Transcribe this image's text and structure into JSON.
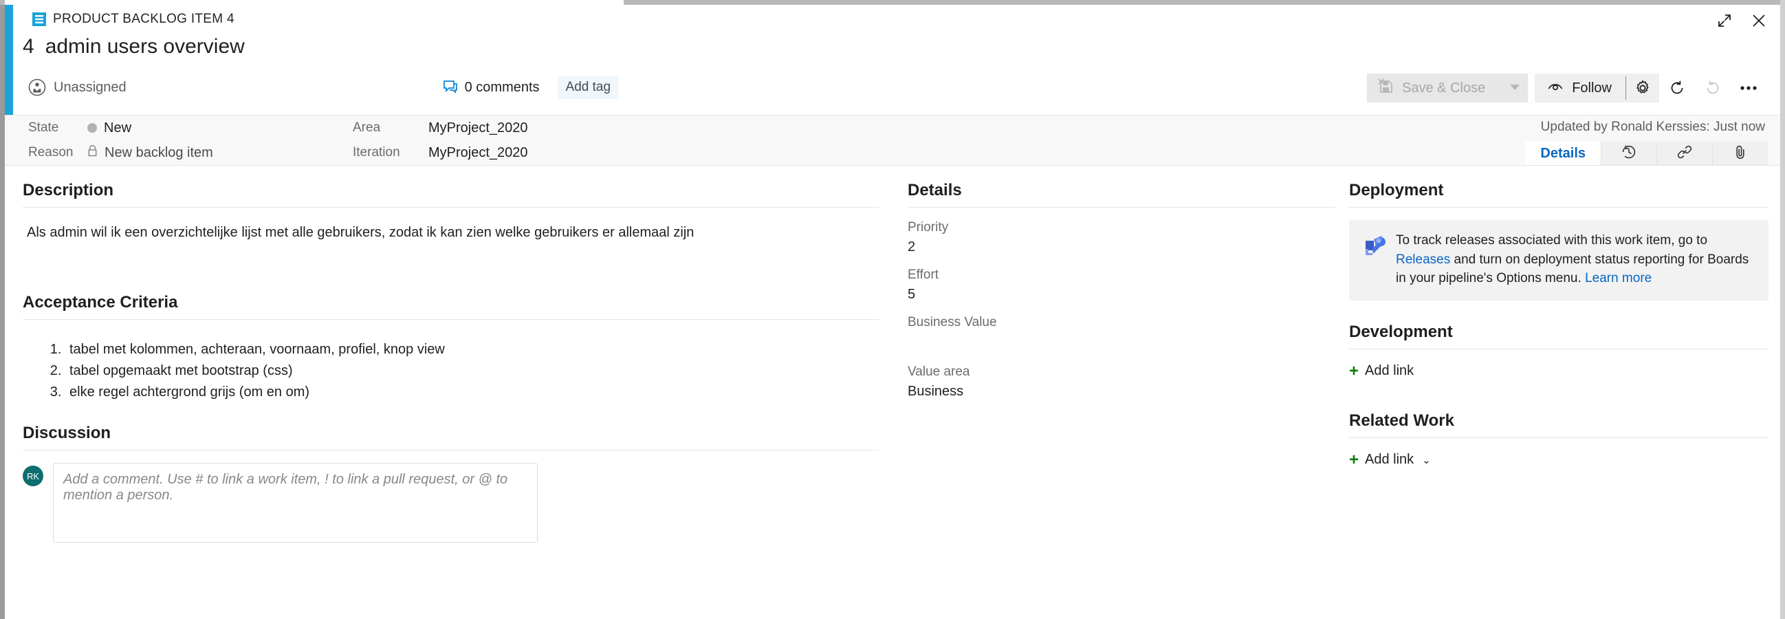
{
  "window": {
    "expand_icon": "expand-icon",
    "close_icon": "close-icon"
  },
  "header": {
    "type_icon": "backlog-item-icon",
    "work_item_type": "PRODUCT BACKLOG ITEM 4",
    "work_item_id": "4",
    "title": "admin users overview",
    "assignee_icon": "person-icon",
    "assignee": "Unassigned",
    "comment_icon": "comment-icon",
    "comments": "0 comments",
    "add_tag": "Add tag"
  },
  "toolbar": {
    "save_icon": "save-close-icon",
    "save_close": "Save & Close",
    "save_caret": "caret-down-icon",
    "follow_icon": "follow-eye-icon",
    "follow": "Follow",
    "gear_icon": "gear-icon",
    "refresh_icon": "refresh-icon",
    "undo_icon": "undo-icon",
    "more_icon": "more-ellipsis-icon"
  },
  "fields": {
    "state_label": "State",
    "state_value": "New",
    "state_color": "#b2b2b2",
    "reason_label": "Reason",
    "reason_value": "New backlog item",
    "reason_icon": "lock-icon",
    "area_label": "Area",
    "area_value": "MyProject_2020",
    "iteration_label": "Iteration",
    "iteration_value": "MyProject_2020"
  },
  "status": {
    "updated_by": "Updated by Ronald Kerssies: Just now"
  },
  "tabs": [
    {
      "label": "Details",
      "icon": "",
      "active": true
    },
    {
      "label": "",
      "icon": "history-icon",
      "active": false
    },
    {
      "label": "",
      "icon": "link-icon",
      "active": false
    },
    {
      "label": "",
      "icon": "attachment-icon",
      "active": false
    }
  ],
  "description": {
    "heading": "Description",
    "body": "Als admin wil ik een overzichtelijke lijst met alle gebruikers, zodat ik kan zien welke gebruikers er allemaal zijn"
  },
  "acceptance_criteria": {
    "heading": "Acceptance Criteria",
    "items": [
      "tabel met kolommen, achteraan, voornaam, profiel, knop view",
      "tabel opgemaakt met bootstrap (css)",
      "elke regel achtergrond grijs (om en om)"
    ]
  },
  "discussion": {
    "heading": "Discussion",
    "avatar_initials": "RK",
    "avatar_color": "#0e6e6e",
    "placeholder": "Add a comment. Use # to link a work item, ! to link a pull request, or @ to mention a person.",
    "value": ""
  },
  "details": {
    "heading": "Details",
    "fields": [
      {
        "label": "Priority",
        "value": "2"
      },
      {
        "label": "Effort",
        "value": "5"
      },
      {
        "label": "Business Value",
        "value": ""
      },
      {
        "label": "Value area",
        "value": "Business"
      }
    ]
  },
  "deployment": {
    "heading": "Deployment",
    "icon": "azure-rocket-icon",
    "text_part1": "To track releases associated with this work item, go to ",
    "link_releases": "Releases",
    "text_part2": " and turn on deployment status reporting for Boards in your pipeline's Options menu. ",
    "link_learn_more": "Learn more"
  },
  "development": {
    "heading": "Development",
    "add_link": "Add link",
    "plus_icon": "plus-icon"
  },
  "related_work": {
    "heading": "Related Work",
    "add_link": "Add link",
    "plus_icon": "plus-icon",
    "chevron": "chevron-down-icon"
  },
  "colors": {
    "accent_bar": "#1aa3d8",
    "link": "#0a66c2",
    "plus_green": "#107c10",
    "tag_bg": "#eff6fc"
  }
}
